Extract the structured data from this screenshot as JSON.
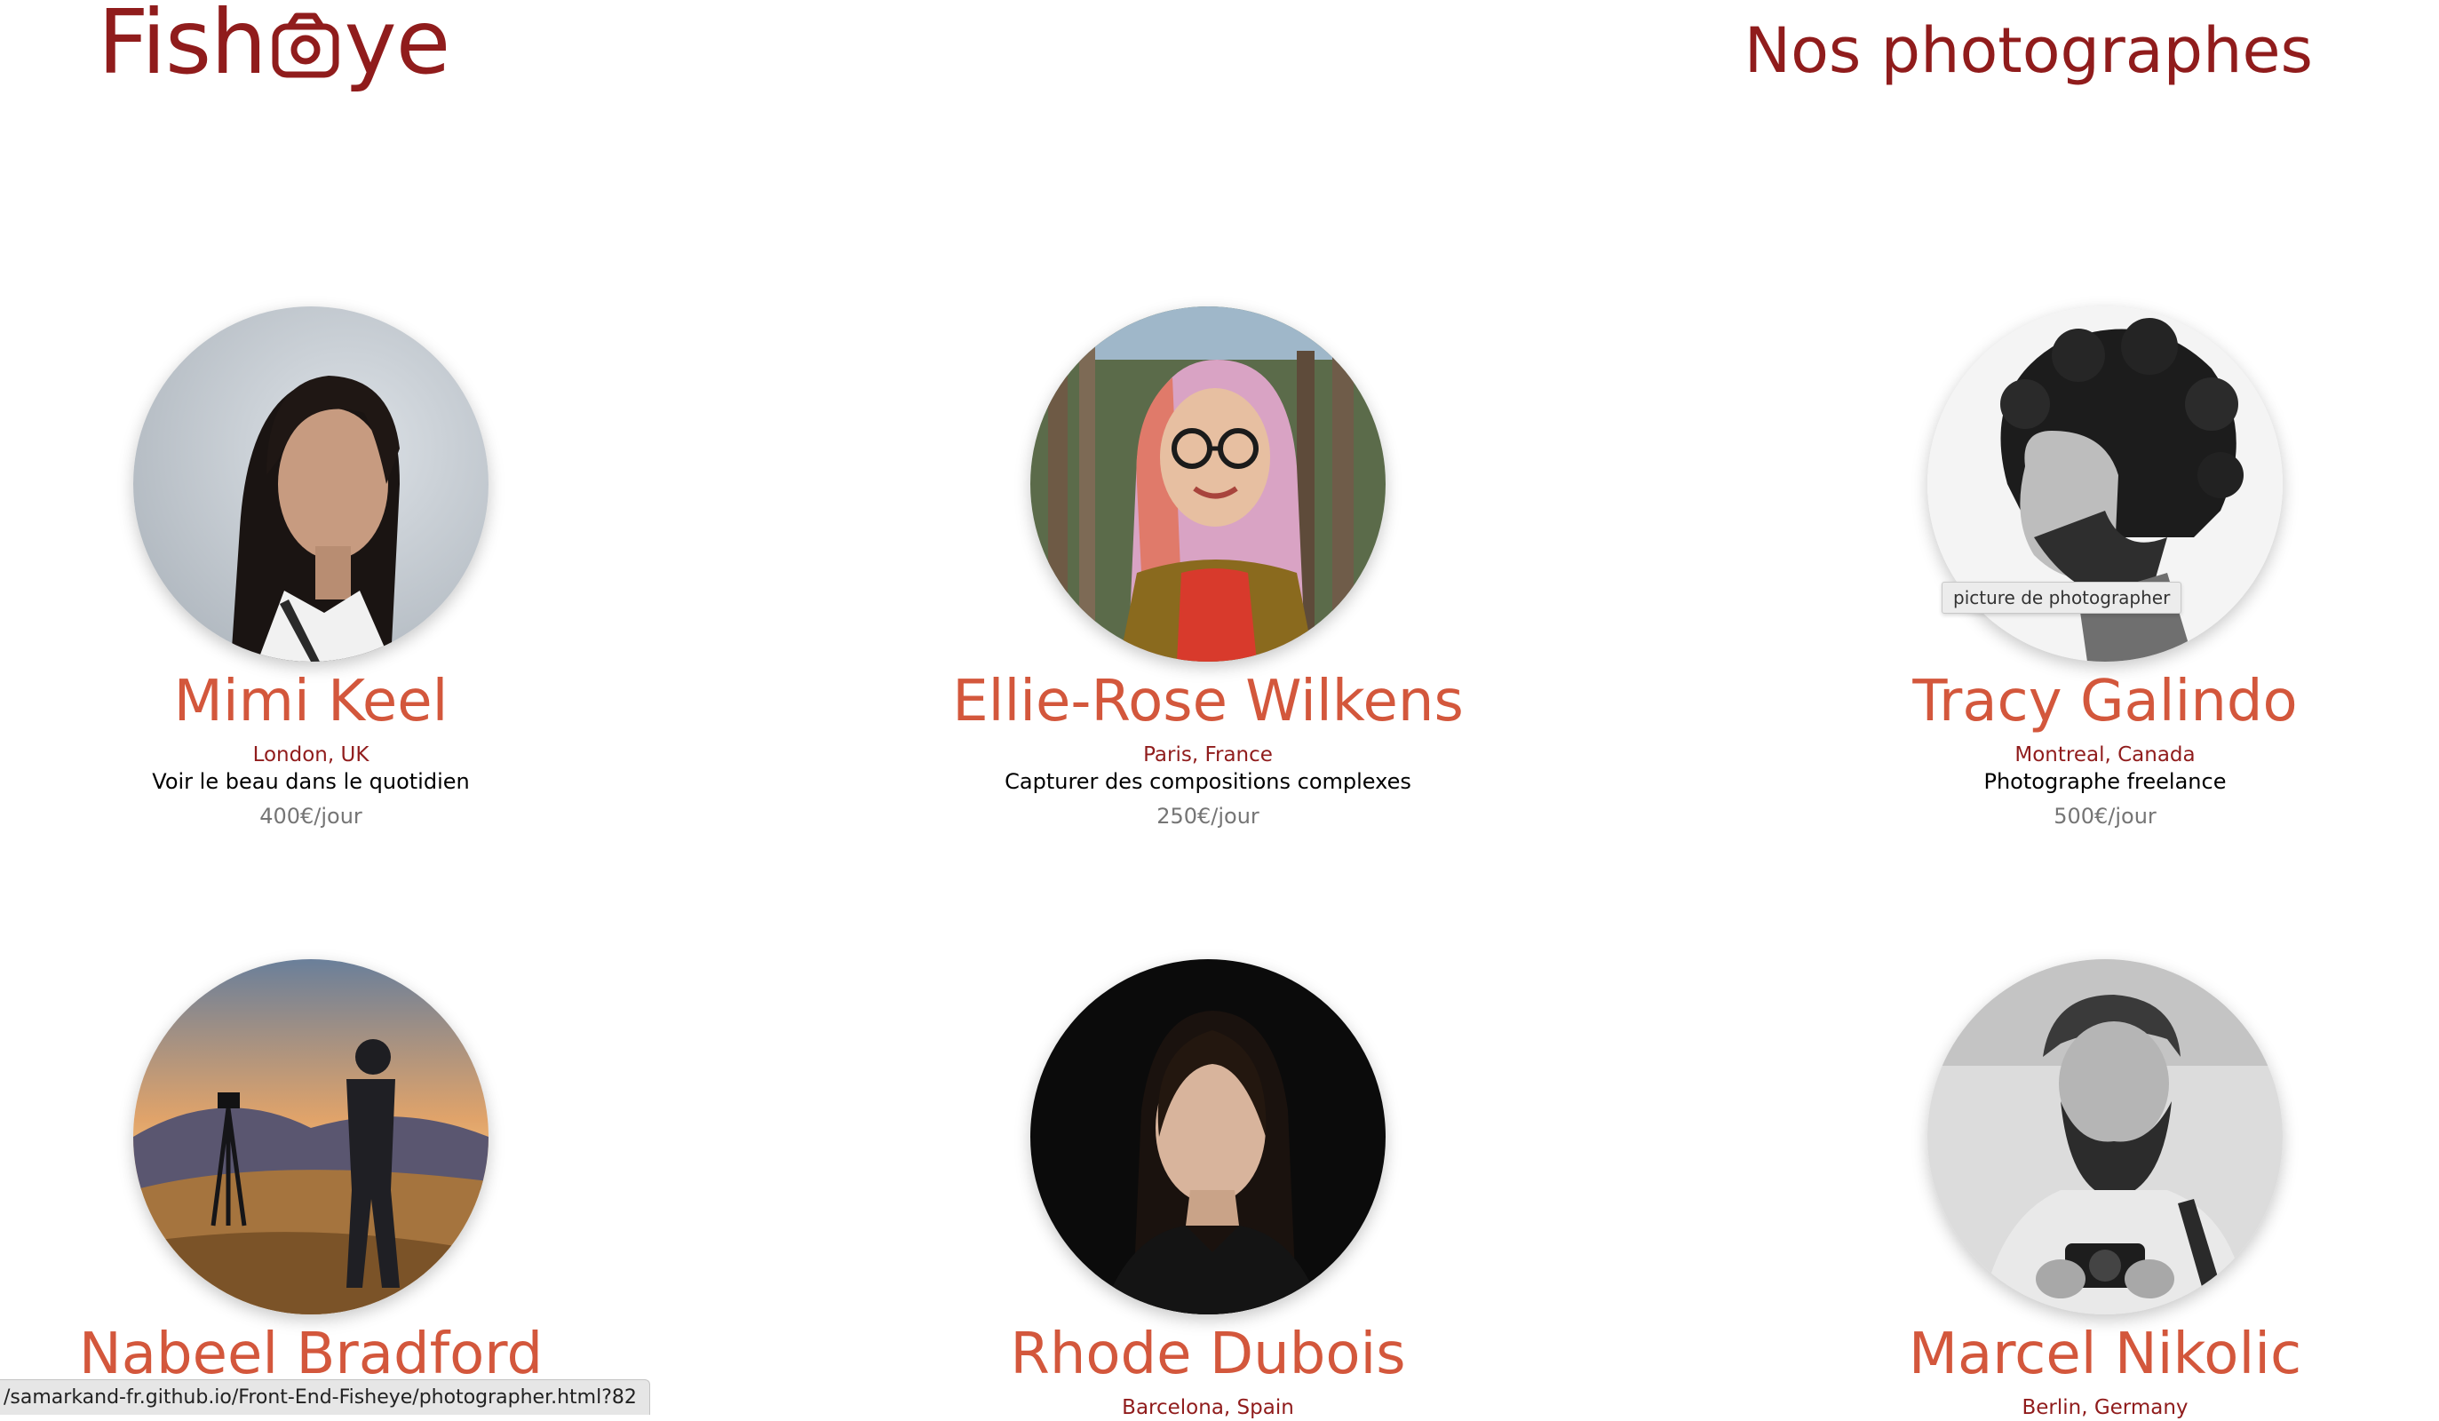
{
  "header": {
    "logo_left": "Fish",
    "logo_right": "ye",
    "logo_icon": "camera-icon",
    "heading": "Nos photographes"
  },
  "photographers": [
    {
      "name": "Mimi Keel",
      "location": "London, UK",
      "tagline": "Voir le beau dans le quotidien",
      "price": "400€/jour",
      "portrait": "portrait-young-woman-grey-background"
    },
    {
      "name": "Ellie-Rose Wilkens",
      "location": "Paris, France",
      "tagline": "Capturer des compositions complexes",
      "price": "250€/jour",
      "portrait": "portrait-woman-glasses-pink-hair"
    },
    {
      "name": "Tracy Galindo",
      "location": "Montreal, Canada",
      "tagline": "Photographe freelance",
      "price": "500€/jour",
      "portrait": "portrait-man-curly-hair-profile-bw"
    },
    {
      "name": "Nabeel Bradford",
      "location": "",
      "tagline": "",
      "price": "",
      "portrait": "photographer-with-tripod-mountain-sunset"
    },
    {
      "name": "Rhode Dubois",
      "location": "Barcelona, Spain",
      "tagline": "",
      "price": "",
      "portrait": "portrait-woman-dark-background"
    },
    {
      "name": "Marcel Nikolic",
      "location": "Berlin, Germany",
      "tagline": "",
      "price": "",
      "portrait": "portrait-bearded-man-camera-bw"
    }
  ],
  "tooltip": "picture de photographer",
  "status_bar": "/samarkand-fr.github.io/Front-End-Fisheye/photographer.html?82",
  "colors": {
    "primary": "#901C1C",
    "secondary": "#D3573C",
    "muted": "#757575"
  }
}
